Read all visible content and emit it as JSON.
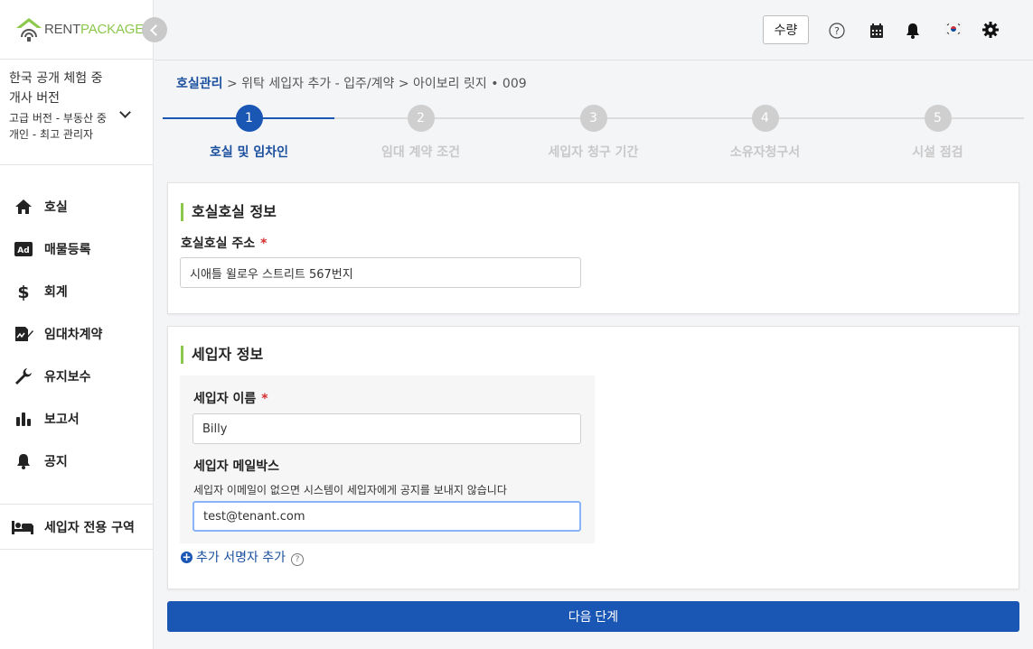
{
  "brand": {
    "name_part1": "RENT",
    "name_part2": "PACKAGE",
    "accent": "#8cc84b"
  },
  "plan": {
    "title": "한국 공개 체험 중 개사 버전",
    "subtitle": "고급 버전 - 부동산 중개인 - 최고 관리자"
  },
  "sidebar": {
    "items": [
      {
        "label": "호실",
        "icon": "home-icon"
      },
      {
        "label": "매물등록",
        "icon": "ad-icon"
      },
      {
        "label": "회계",
        "icon": "dollar-icon"
      },
      {
        "label": "임대차계약",
        "icon": "contract-sign-icon"
      },
      {
        "label": "유지보수",
        "icon": "wrench-icon"
      },
      {
        "label": "보고서",
        "icon": "bar-chart-icon"
      },
      {
        "label": "공지",
        "icon": "bell-icon"
      }
    ],
    "tenant_area": {
      "label": "세입자 전용 구역",
      "icon": "bed-icon"
    }
  },
  "header": {
    "qty_label": "수량",
    "icons": [
      "help-icon",
      "calendar-icon",
      "notification-bell-icon",
      "korea-flag-icon",
      "settings-gear-icon"
    ]
  },
  "breadcrumb": {
    "root": "호실관리",
    "rest": " > 위탁 세입자 추가 - 입주/계약 > 아이보리 릿지 • 009"
  },
  "steps": [
    {
      "num": "1",
      "label": "호실 및 임차인",
      "active": true
    },
    {
      "num": "2",
      "label": "임대 계약 조건",
      "active": false
    },
    {
      "num": "3",
      "label": "세입자 청구 기간",
      "active": false
    },
    {
      "num": "4",
      "label": "소유자청구서",
      "active": false
    },
    {
      "num": "5",
      "label": "시설 점검",
      "active": false
    }
  ],
  "room_card": {
    "title": "호실호실 정보",
    "address_label": "호실호실 주소",
    "required_mark": "*",
    "address_value": "시애틀 윌로우 스트리트 567번지"
  },
  "tenant_card": {
    "title": "세입자 정보",
    "name_label": "세입자 이름",
    "required_mark": "*",
    "name_value": "Billy",
    "email_label": "세입자 메일박스",
    "email_hint": "세입자 이메일이 없으면 시스템이 세입자에게 공지를 보내지 않습니다",
    "email_value": "test@tenant.com",
    "add_signer_label": "추가 서명자 추가",
    "help_mark": "?"
  },
  "next_button": {
    "label": "다음 단계",
    "color": "#1a56b4"
  }
}
